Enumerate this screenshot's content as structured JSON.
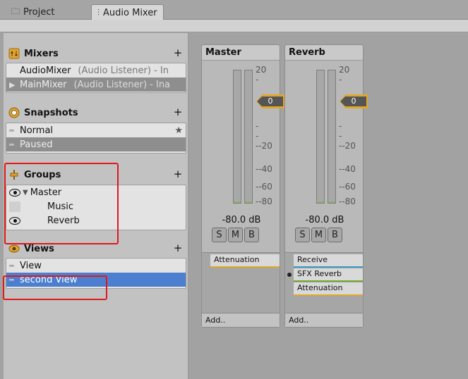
{
  "tabs": [
    {
      "label": "Project",
      "icon": "folder-icon"
    },
    {
      "label": "Audio Mixer",
      "icon": "mixer-icon"
    }
  ],
  "mixers": {
    "title": "Mixers",
    "add": "+",
    "items": [
      {
        "name": "AudioMixer",
        "desc": "(Audio Listener) - In"
      },
      {
        "name": "MainMixer",
        "desc": "(Audio Listener) - Ina"
      }
    ]
  },
  "snapshots": {
    "title": "Snapshots",
    "add": "+",
    "items": [
      "Normal",
      "Paused"
    ],
    "star": "★"
  },
  "groups": {
    "title": "Groups",
    "add": "+",
    "items": [
      "Master",
      "Music",
      "Reverb"
    ]
  },
  "views": {
    "title": "Views",
    "add": "+",
    "items": [
      "View",
      "second View"
    ]
  },
  "strips": [
    {
      "name": "Master",
      "level": "0",
      "db": "-80.0 dB",
      "buttons": [
        "S",
        "M",
        "B"
      ],
      "effects": [
        {
          "name": "Attenuation",
          "color": "#e0a72a"
        }
      ],
      "add": "Add.."
    },
    {
      "name": "Reverb",
      "level": "0",
      "db": "-80.0 dB",
      "buttons": [
        "S",
        "M",
        "B"
      ],
      "effects": [
        {
          "name": "Receive",
          "color": "#3a9cc5"
        },
        {
          "name": "SFX Reverb",
          "color": "#6faa2c"
        },
        {
          "name": "Attenuation",
          "color": "#e0a72a"
        }
      ],
      "add": "Add.."
    }
  ],
  "scale_labels": [
    "20",
    "-",
    "-",
    "-",
    "--20",
    "--40",
    "--60",
    "--80"
  ],
  "colors": {
    "accent": "#e0a72a",
    "selection": "#4c7fcf",
    "highlight": "#e0191b"
  }
}
